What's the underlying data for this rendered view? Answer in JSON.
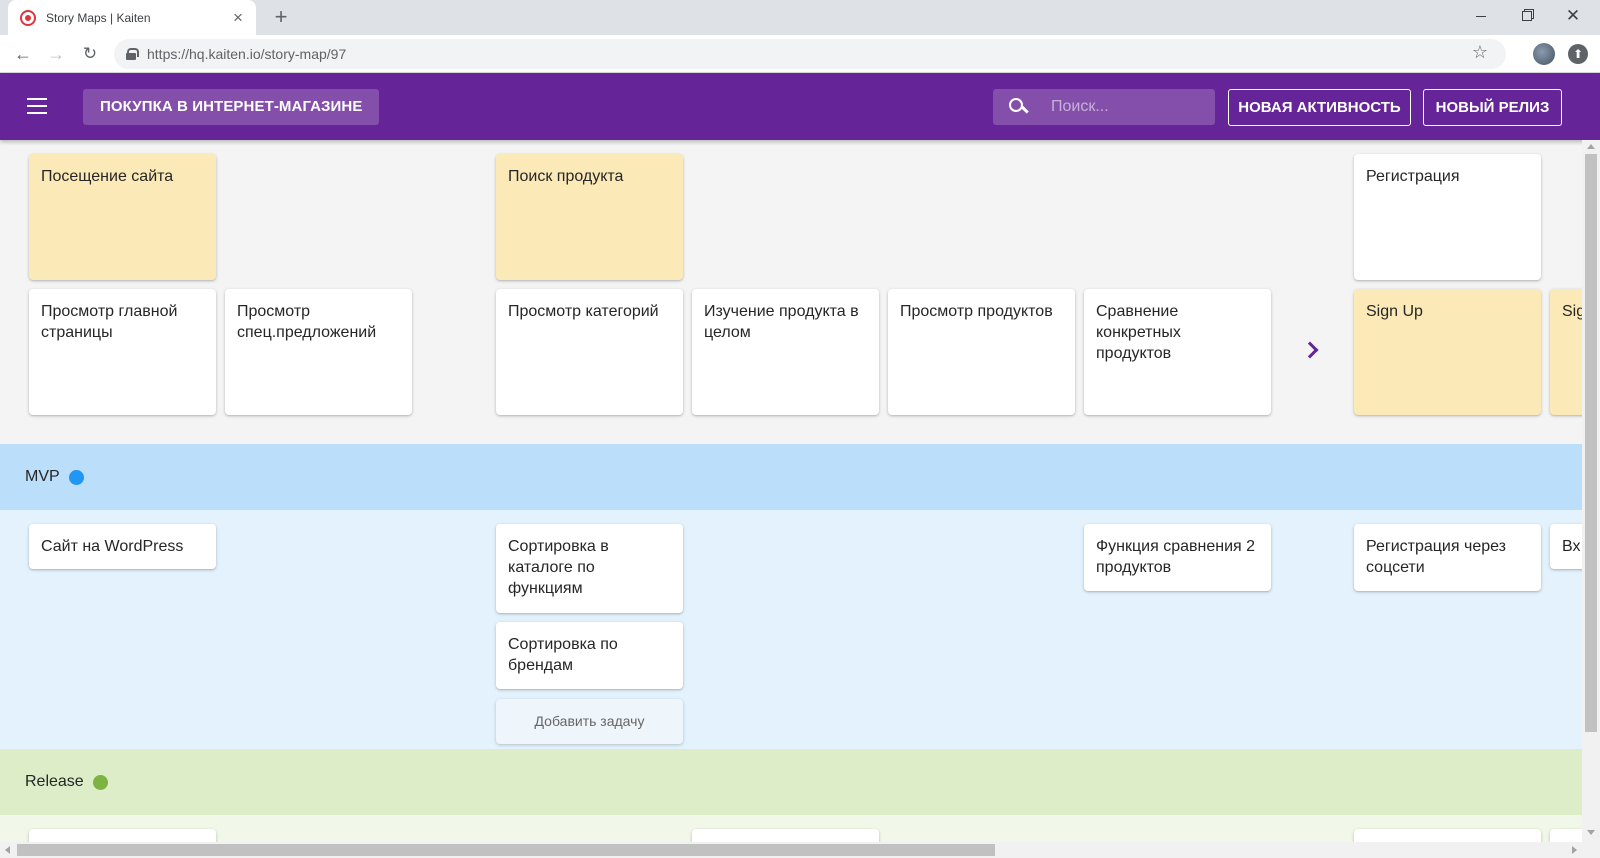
{
  "browser": {
    "tab_title": "Story Maps | Kaiten",
    "url_host": "https://hq.kaiten.io",
    "url_path": "/story-map/97",
    "new_tab": "+",
    "close_tab": "×"
  },
  "header": {
    "map_title": "ПОКУПКА В ИНТЕРНЕТ-МАГАЗИНЕ",
    "search_placeholder": "Поиск...",
    "new_activity": "НОВАЯ АКТИВНОСТЬ",
    "new_release": "НОВЫЙ РЕЛИЗ"
  },
  "activities": [
    {
      "label": "Посещение сайта",
      "color": "#fbe9b7"
    },
    {
      "label": "Поиск продукта",
      "color": "#fbe9b7"
    },
    {
      "label": "Регистрация",
      "color": "#ffffff"
    }
  ],
  "steps": [
    {
      "label": "Просмотр главной страницы"
    },
    {
      "label": "Просмотр спец.предложений"
    },
    {
      "label": "Просмотр категорий"
    },
    {
      "label": "Изучение продукта в целом"
    },
    {
      "label": "Просмотр продуктов"
    },
    {
      "label": "Сравнение конкретных продуктов"
    },
    {
      "label": "Sign Up"
    },
    {
      "label": "Sig"
    }
  ],
  "releases": [
    {
      "name": "MVP",
      "color": "#2196f3"
    },
    {
      "name": "Release",
      "color": "#7cb342"
    }
  ],
  "mvp_tasks": [
    {
      "label": "Сайт на WordPress"
    },
    {
      "label": "Сортировка в каталоге по функциям"
    },
    {
      "label": "Сортировка по брендам"
    },
    {
      "label": "Функция сравнения 2 продуктов"
    },
    {
      "label": "Регистрация через соцсети"
    },
    {
      "label": "Вх"
    }
  ],
  "add_task_label": "Добавить задачу",
  "colors": {
    "header_bg": "#652497",
    "mvp_band": "#bbdefb",
    "release_band": "#dcedc8"
  }
}
